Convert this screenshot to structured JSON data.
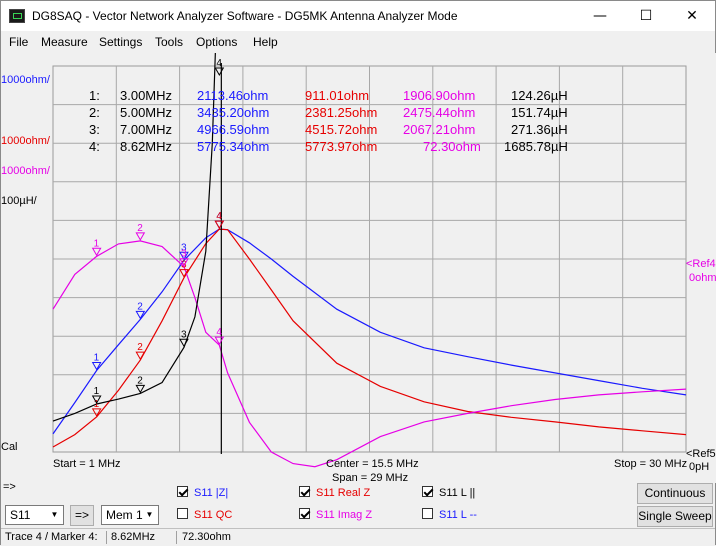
{
  "window": {
    "app_name": "DG8SAQ",
    "title": "DG8SAQ  -  Vector Network Analyzer Software - DG5MK Antenna Analyzer Mode",
    "minimize_glyph": "—",
    "maximize_glyph": "☐",
    "close_glyph": "✕"
  },
  "menu": [
    "File",
    "Measure",
    "Settings",
    "Tools",
    "Options",
    "Help"
  ],
  "colors": {
    "black": "#000000",
    "blue": "#1a1aff",
    "red": "#e60000",
    "magenta": "#e600e6",
    "grid": "#9a9a9a",
    "plot_bg": "#f0f0f0"
  },
  "left_scale": [
    {
      "text": "1000ohm/",
      "color": "#1a1aff"
    },
    {
      "text": "1000ohm/",
      "color": "#e60000"
    },
    {
      "text": "1000ohm/",
      "color": "#e600e6"
    },
    {
      "text": "100µH/",
      "color": "#000000"
    }
  ],
  "left_bottom_label": "Cal",
  "right_labels": {
    "ref4_top": "<Ref4",
    "ref4_bottom": "0ohm",
    "ref5_top": "<Ref5",
    "ref5_bottom": "0pH"
  },
  "marker_table": [
    {
      "id": "1:",
      "freq": "3.00MHz",
      "absz": "2113.46ohm",
      "realz": "911.01ohm",
      "imagz": "1906.90ohm",
      "l": "124.26µH"
    },
    {
      "id": "2:",
      "freq": "5.00MHz",
      "absz": "3435.20ohm",
      "realz": "2381.25ohm",
      "imagz": "2475.44ohm",
      "l": "151.74µH"
    },
    {
      "id": "3:",
      "freq": "7.00MHz",
      "absz": "4966.59ohm",
      "realz": "4515.72ohm",
      "imagz": "2067.21ohm",
      "l": "271.36µH"
    },
    {
      "id": "4:",
      "freq": "8.62MHz",
      "absz": "5775.34ohm",
      "realz": "5773.97ohm",
      "imagz": "72.30ohm",
      "l": "1685.78µH"
    }
  ],
  "marker_labels": [
    "1",
    "2",
    "3",
    "4"
  ],
  "active_marker_label": "4",
  "axis_footer": {
    "start": "Start = 1 MHz",
    "center": "Center = 15.5 MHz",
    "span": "Span = 29 MHz",
    "stop": "Stop = 30 MHz"
  },
  "arrow_label": "=>",
  "chart_data": {
    "type": "line",
    "x_range_mhz": [
      1,
      30
    ],
    "grid": true,
    "divisions": {
      "x": 10,
      "y": 10
    },
    "series": [
      {
        "name": "S11 |Z|",
        "color": "#1a1aff",
        "x": [
          1,
          2,
          3,
          4,
          5,
          6,
          7,
          8,
          8.62,
          9,
          10,
          11,
          12,
          14,
          16,
          18,
          20,
          22,
          24,
          26,
          28,
          30
        ],
        "y": [
          470,
          1280,
          2113,
          2780,
          3435,
          4150,
          4967,
          5550,
          5775,
          5760,
          5420,
          5000,
          4550,
          3700,
          3100,
          2700,
          2470,
          2250,
          2050,
          1850,
          1650,
          1480
        ]
      },
      {
        "name": "S11 Real Z",
        "color": "#e60000",
        "x": [
          1,
          2,
          3,
          4,
          5,
          6,
          7,
          8,
          8.62,
          9,
          10,
          11,
          12,
          14,
          16,
          18,
          20,
          22,
          24,
          26,
          28,
          30
        ],
        "y": [
          130,
          450,
          911,
          1600,
          2381,
          3400,
          4516,
          5400,
          5774,
          5760,
          5000,
          4200,
          3400,
          2300,
          1700,
          1300,
          1050,
          900,
          780,
          650,
          550,
          450
        ]
      },
      {
        "name": "S11 Imag Z",
        "color": "#e600e6",
        "x": [
          1,
          2,
          3,
          4,
          5,
          6,
          7,
          7.5,
          8,
          8.62,
          9,
          10,
          11,
          12,
          13,
          14,
          16,
          18,
          20,
          22,
          24,
          26,
          28,
          30
        ],
        "y": [
          6700,
          7600,
          8070,
          8390,
          8470,
          8320,
          7800,
          7000,
          6100,
          5770,
          5050,
          3770,
          3000,
          2700,
          2620,
          2800,
          3400,
          3780,
          4000,
          4200,
          4360,
          4480,
          4560,
          4630
        ]
      },
      {
        "name": "S11 L ||",
        "color": "#000000",
        "x": [
          1,
          2,
          3,
          4,
          5,
          6,
          7,
          7.5,
          8,
          8.3,
          8.5,
          8.62
        ],
        "y": [
          80,
          100,
          124.26,
          137,
          151.74,
          180,
          271.36,
          350,
          520,
          800,
          1200,
          1685.78
        ]
      }
    ]
  },
  "trace_controls": [
    {
      "label": "S11  |Z|",
      "checked": true,
      "color": "#1a1aff"
    },
    {
      "label": "S11  Real Z",
      "checked": true,
      "color": "#e60000"
    },
    {
      "label": "S11  L ||",
      "checked": true,
      "color": "#000000"
    },
    {
      "label": "S11  QC",
      "checked": false,
      "color": "#e60000"
    },
    {
      "label": "S11  Imag Z",
      "checked": true,
      "color": "#e600e6"
    },
    {
      "label": "S11  L --",
      "checked": false,
      "color": "#1a1aff"
    }
  ],
  "controls": {
    "port_select": "S11",
    "arrow_button": "=>",
    "memory_select": "Mem 1",
    "continuous": "Continuous",
    "single_sweep": "Single Sweep",
    "dropdown_arrow": "▼"
  },
  "statusbar": {
    "trace_marker": "Trace 4 / Marker 4:",
    "freq": "8.62MHz",
    "value": "72.30ohm"
  }
}
